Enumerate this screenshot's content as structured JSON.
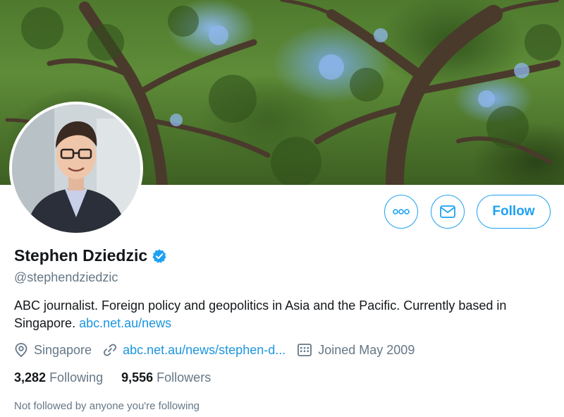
{
  "profile": {
    "display_name": "Stephen Dziedzic",
    "handle": "@stephendziedzic",
    "bio_text": "ABC journalist. Foreign policy and geopolitics in Asia and the Pacific. Currently based in Singapore. ",
    "bio_link": "abc.net.au/news",
    "location": "Singapore",
    "website": "abc.net.au/news/stephen-d...",
    "joined": "Joined May 2009",
    "following_count": "3,282",
    "following_label": "Following",
    "followers_count": "9,556",
    "followers_label": "Followers",
    "social_context": "Not followed by anyone you're following"
  },
  "actions": {
    "more_icon": "more-icon",
    "message_icon": "message-icon",
    "follow_label": "Follow"
  },
  "icons": {
    "verified": "verified-badge-icon",
    "location": "location-pin-icon",
    "link": "link-icon",
    "calendar": "calendar-icon"
  },
  "colors": {
    "accent": "#1da1f2",
    "link": "#1b95e0",
    "secondary_text": "#657786",
    "primary_text": "#14171a"
  }
}
